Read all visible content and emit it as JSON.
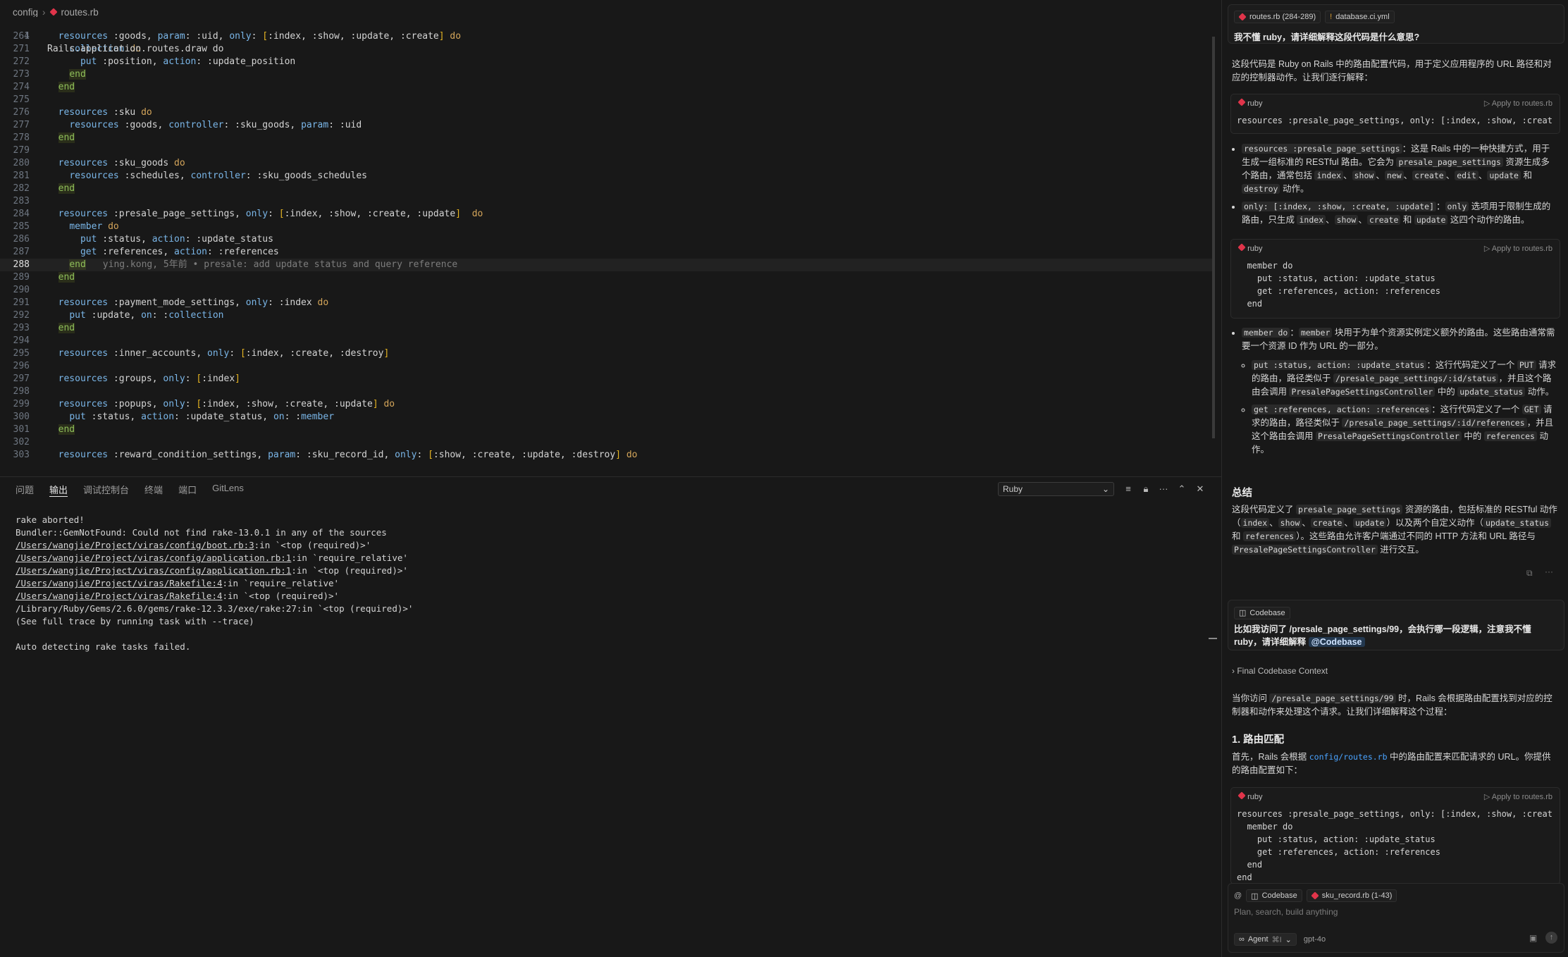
{
  "breadcrumb": {
    "folder": "config",
    "file": "routes.rb"
  },
  "editor": {
    "sticky": {
      "ln": "1",
      "text": "Rails.application.routes.draw do"
    },
    "lines": [
      {
        "ln": "264",
        "text": "  resources :goods, param: :uid, only: [:index, :show, :update, :create] do"
      },
      {
        "ln": "271",
        "text": "    collection do"
      },
      {
        "ln": "272",
        "text": "      put :position, action: :update_position"
      },
      {
        "ln": "273",
        "text": "    end"
      },
      {
        "ln": "274",
        "text": "  end"
      },
      {
        "ln": "275",
        "text": ""
      },
      {
        "ln": "276",
        "text": "  resources :sku do"
      },
      {
        "ln": "277",
        "text": "    resources :goods, controller: :sku_goods, param: :uid"
      },
      {
        "ln": "278",
        "text": "  end"
      },
      {
        "ln": "279",
        "text": ""
      },
      {
        "ln": "280",
        "text": "  resources :sku_goods do"
      },
      {
        "ln": "281",
        "text": "    resources :schedules, controller: :sku_goods_schedules"
      },
      {
        "ln": "282",
        "text": "  end"
      },
      {
        "ln": "283",
        "text": ""
      },
      {
        "ln": "284",
        "text": "  resources :presale_page_settings, only: [:index, :show, :create, :update]  do"
      },
      {
        "ln": "285",
        "text": "    member do"
      },
      {
        "ln": "286",
        "text": "      put :status, action: :update_status"
      },
      {
        "ln": "287",
        "text": "      get :references, action: :references"
      },
      {
        "ln": "288",
        "text": "    end"
      },
      {
        "ln": "289",
        "text": "  end"
      },
      {
        "ln": "290",
        "text": ""
      },
      {
        "ln": "291",
        "text": "  resources :payment_mode_settings, only: :index do"
      },
      {
        "ln": "292",
        "text": "    put :update, on: :collection"
      },
      {
        "ln": "293",
        "text": "  end"
      },
      {
        "ln": "294",
        "text": ""
      },
      {
        "ln": "295",
        "text": "  resources :inner_accounts, only: [:index, :create, :destroy]"
      },
      {
        "ln": "296",
        "text": ""
      },
      {
        "ln": "297",
        "text": "  resources :groups, only: [:index]"
      },
      {
        "ln": "298",
        "text": ""
      },
      {
        "ln": "299",
        "text": "  resources :popups, only: [:index, :show, :create, :update] do"
      },
      {
        "ln": "300",
        "text": "    put :status, action: :update_status, on: :member"
      },
      {
        "ln": "301",
        "text": "  end"
      },
      {
        "ln": "302",
        "text": ""
      },
      {
        "ln": "303",
        "text": "  resources :reward_condition_settings, param: :sku_record_id, only: [:show, :create, :update, :destroy] do"
      }
    ],
    "blame": "ying.kong, 5年前 • presale: add update status and query reference"
  },
  "panel": {
    "tabs": [
      "问题",
      "输出",
      "调试控制台",
      "终端",
      "端口",
      "GitLens"
    ],
    "active_tab": "输出",
    "channel": "Ruby",
    "output": [
      {
        "text": "rake aborted!",
        "link": false
      },
      {
        "text": "Bundler::GemNotFound: Could not find rake-13.0.1 in any of the sources",
        "link": false
      },
      {
        "link_text": "/Users/wangjie/Project/viras/config/boot.rb:3",
        "rest": ":in `<top (required)>'",
        "link": true
      },
      {
        "link_text": "/Users/wangjie/Project/viras/config/application.rb:1",
        "rest": ":in `require_relative'",
        "link": true
      },
      {
        "link_text": "/Users/wangjie/Project/viras/config/application.rb:1",
        "rest": ":in `<top (required)>'",
        "link": true
      },
      {
        "link_text": "/Users/wangjie/Project/viras/Rakefile:4",
        "rest": ":in `require_relative'",
        "link": true
      },
      {
        "link_text": "/Users/wangjie/Project/viras/Rakefile:4",
        "rest": ":in `<top (required)>'",
        "link": true
      },
      {
        "text": "/Library/Ruby/Gems/2.6.0/gems/rake-12.3.3/exe/rake:27:in `<top (required)>'",
        "link": false
      },
      {
        "text": "(See full trace by running task with --trace)",
        "link": false
      },
      {
        "text": "",
        "link": false
      },
      {
        "text": "Auto detecting rake tasks failed.",
        "link": false
      }
    ]
  },
  "chat": {
    "ctx_chips": [
      "routes.rb (284-289)",
      "database.ci.yml"
    ],
    "q1": "我不懂 ruby，请详细解释这段代码是什么意思?",
    "a1_intro": "这段代码是 Ruby on Rails 中的路由配置代码，用于定义应用程序的 URL 路径和对应的控制器动作。让我们逐行解释：",
    "code_lang": "ruby",
    "apply_label": "Apply to routes.rb",
    "code1": "resources :presale_page_settings, only: [:index, :show, :creat",
    "code2": "  member do\n    put :status, action: :update_status\n    get :references, action: :references\n  end",
    "summary_title": "总结",
    "codebase_chip": "Codebase",
    "q2": "比如我访问了 /presale_page_settings/99，会执行哪一段逻辑，注意我不懂 ruby，请详细解释",
    "q2_mention": "@Codebase",
    "final_ctx": "Final Codebase Context",
    "a2_step1": "1. 路由匹配",
    "code3": "resources :presale_page_settings, only: [:index, :show, :creat\n  member do\n    put :status, action: :update_status\n    get :references, action: :references\n  end\nend",
    "input_chips": [
      "Codebase",
      "sku_record.rb (1-43)"
    ],
    "input_placeholder": "Plan, search, build anything",
    "agent_label": "Agent",
    "agent_shortcut": "⌘I",
    "model": "gpt-4o"
  }
}
